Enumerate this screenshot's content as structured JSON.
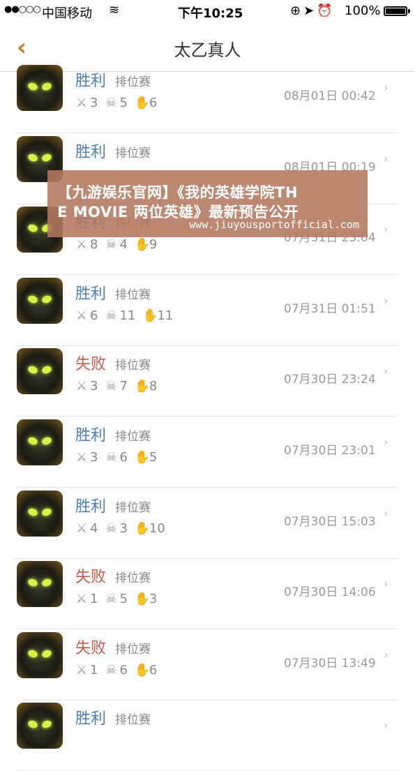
{
  "status_bar": {
    "signal": "●●○○○",
    "carrier": "中国移动",
    "wifi_icon": "≋",
    "time": "下午10:25",
    "icons": "⊕➤⏰",
    "battery": "100%"
  },
  "nav": {
    "back_icon": "‹",
    "title": "太乙真人"
  },
  "matches": [
    {
      "result": "胜利",
      "type": "win",
      "mode": "排位赛",
      "kills": "3",
      "deaths": "5",
      "assists": "6",
      "date": "08月01日 00:42"
    },
    {
      "result": "胜利",
      "type": "win",
      "mode": "排位赛",
      "kills": "",
      "deaths": "",
      "assists": "",
      "date": "08月01日 00:19"
    },
    {
      "result": "胜利",
      "type": "win",
      "mode": "排位赛",
      "kills": "8",
      "deaths": "4",
      "assists": "9",
      "date": "07月31日 23:04"
    },
    {
      "result": "胜利",
      "type": "win",
      "mode": "排位赛",
      "kills": "6",
      "deaths": "11",
      "assists": "11",
      "date": "07月31日 01:51"
    },
    {
      "result": "失败",
      "type": "lose",
      "mode": "排位赛",
      "kills": "3",
      "deaths": "7",
      "assists": "8",
      "date": "07月30日 23:24"
    },
    {
      "result": "胜利",
      "type": "win",
      "mode": "排位赛",
      "kills": "3",
      "deaths": "6",
      "assists": "5",
      "date": "07月30日 23:01"
    },
    {
      "result": "胜利",
      "type": "win",
      "mode": "排位赛",
      "kills": "4",
      "deaths": "3",
      "assists": "10",
      "date": "07月30日 15:03"
    },
    {
      "result": "失败",
      "type": "lose",
      "mode": "排位赛",
      "kills": "1",
      "deaths": "5",
      "assists": "3",
      "date": "07月30日 14:06"
    },
    {
      "result": "失败",
      "type": "lose",
      "mode": "排位赛",
      "kills": "1",
      "deaths": "6",
      "assists": "6",
      "date": "07月30日 13:49"
    },
    {
      "result": "胜利",
      "type": "win",
      "mode": "排位赛",
      "kills": "",
      "deaths": "",
      "assists": "",
      "date": ""
    }
  ],
  "icons": {
    "kills": "⚔",
    "deaths": "☠",
    "assists": "✋",
    "chevron": "›"
  },
  "watermark": {
    "line1": "【九游娱乐官网】《我的英雄学院TH",
    "line2": "E MOVIE 两位英雄》最新预告公开",
    "url": "www.jiuyousportofficial.com"
  }
}
